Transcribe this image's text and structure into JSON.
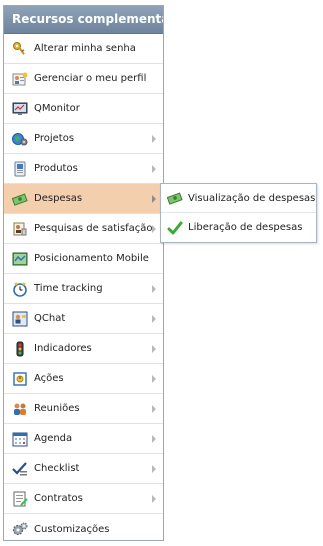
{
  "panel": {
    "title": "Recursos complementares"
  },
  "menu": [
    {
      "label": "Alterar minha senha",
      "icon": "keys-icon",
      "has_submenu": false
    },
    {
      "label": "Gerenciar o meu perfil",
      "icon": "profile-icon",
      "has_submenu": false
    },
    {
      "label": "QMonitor",
      "icon": "monitor-icon",
      "has_submenu": false
    },
    {
      "label": "Projetos",
      "icon": "projects-icon",
      "has_submenu": true
    },
    {
      "label": "Produtos",
      "icon": "products-icon",
      "has_submenu": true
    },
    {
      "label": "Despesas",
      "icon": "money-icon",
      "has_submenu": true,
      "active": true
    },
    {
      "label": "Pesquisas de satisfação",
      "icon": "survey-icon",
      "has_submenu": true
    },
    {
      "label": "Posicionamento Mobile",
      "icon": "map-icon",
      "has_submenu": false
    },
    {
      "label": "Time tracking",
      "icon": "clock-icon",
      "has_submenu": true
    },
    {
      "label": "QChat",
      "icon": "chat-icon",
      "has_submenu": true
    },
    {
      "label": "Indicadores",
      "icon": "traffic-light-icon",
      "has_submenu": true
    },
    {
      "label": "Ações",
      "icon": "actions-icon",
      "has_submenu": true
    },
    {
      "label": "Reuniões",
      "icon": "meeting-icon",
      "has_submenu": true
    },
    {
      "label": "Agenda",
      "icon": "calendar-icon",
      "has_submenu": true
    },
    {
      "label": "Checklist",
      "icon": "checklist-icon",
      "has_submenu": true
    },
    {
      "label": "Contratos",
      "icon": "contract-icon",
      "has_submenu": true
    },
    {
      "label": "Customizações",
      "icon": "gears-icon",
      "has_submenu": false
    }
  ],
  "submenu": {
    "items": [
      {
        "label": "Visualização de despesas",
        "icon": "money-icon"
      },
      {
        "label": "Liberação de despesas",
        "icon": "checkmark-icon"
      }
    ]
  },
  "colors": {
    "header_bg": "#7f93ab",
    "active_bg": "#f3cfae",
    "border": "#9aa7b5"
  }
}
